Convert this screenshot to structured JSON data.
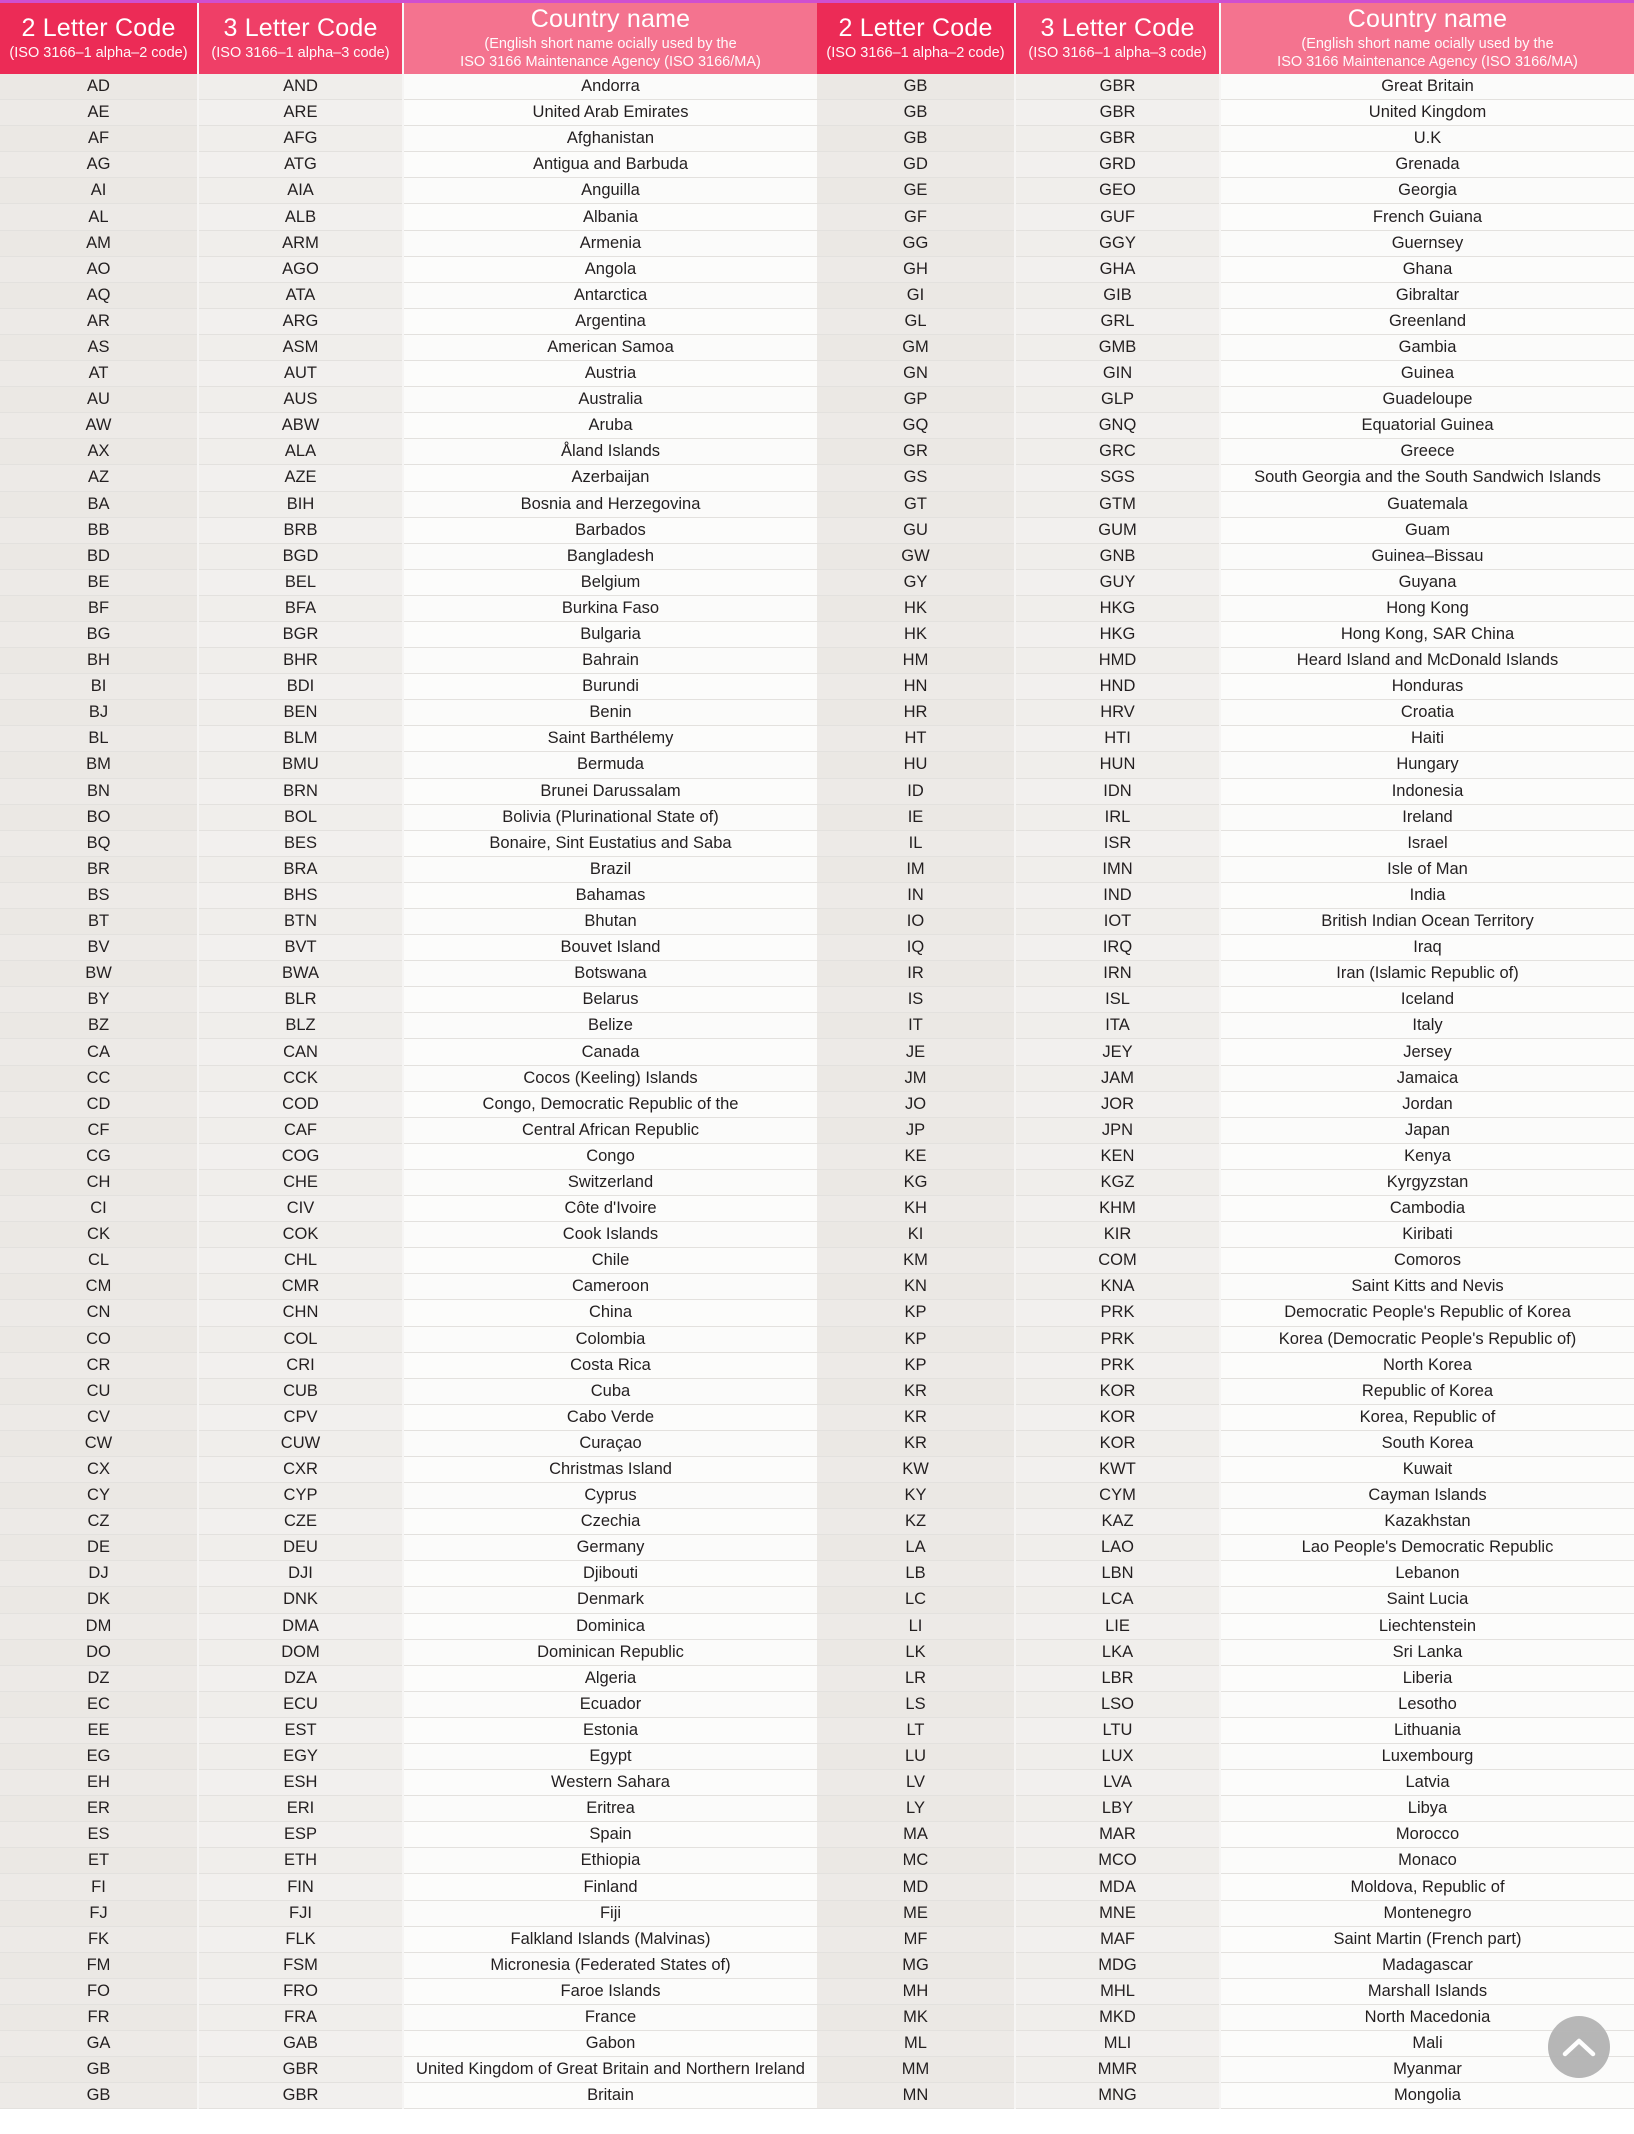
{
  "headers": {
    "code2_title": "2 Letter Code",
    "code2_sub": "(ISO 3166–1 alpha–2 code)",
    "code3_title": "3 Letter Code",
    "code3_sub": "(ISO 3166–1 alpha–3 code)",
    "name_title": "Country name",
    "name_sub_line1": "(English short name ocially used by the",
    "name_sub_line2": "ISO 3166 Maintenance Agency (ISO 3166/MA)"
  },
  "colors": {
    "header_code2": "#ec2b56",
    "header_code3": "#ef3f67",
    "header_name": "#f4738f",
    "top_accent": "#cf4fd0",
    "row_code_bg": "#ebe8e4",
    "row_name_bg": "#fbfbfa",
    "row_border": "#e3e1de",
    "scroll_btn_bg": "#b3b3b3"
  },
  "scroll_top_button": {
    "icon": "chevron-up-icon",
    "label": "Scroll to top"
  },
  "left_table": [
    [
      "AD",
      "AND",
      "Andorra"
    ],
    [
      "AE",
      "ARE",
      "United Arab Emirates"
    ],
    [
      "AF",
      "AFG",
      "Afghanistan"
    ],
    [
      "AG",
      "ATG",
      "Antigua and Barbuda"
    ],
    [
      "AI",
      "AIA",
      "Anguilla"
    ],
    [
      "AL",
      "ALB",
      "Albania"
    ],
    [
      "AM",
      "ARM",
      "Armenia"
    ],
    [
      "AO",
      "AGO",
      "Angola"
    ],
    [
      "AQ",
      "ATA",
      "Antarctica"
    ],
    [
      "AR",
      "ARG",
      "Argentina"
    ],
    [
      "AS",
      "ASM",
      "American Samoa"
    ],
    [
      "AT",
      "AUT",
      "Austria"
    ],
    [
      "AU",
      "AUS",
      "Australia"
    ],
    [
      "AW",
      "ABW",
      "Aruba"
    ],
    [
      "AX",
      "ALA",
      "Åland Islands"
    ],
    [
      "AZ",
      "AZE",
      "Azerbaijan"
    ],
    [
      "BA",
      "BIH",
      "Bosnia and Herzegovina"
    ],
    [
      "BB",
      "BRB",
      "Barbados"
    ],
    [
      "BD",
      "BGD",
      "Bangladesh"
    ],
    [
      "BE",
      "BEL",
      "Belgium"
    ],
    [
      "BF",
      "BFA",
      "Burkina Faso"
    ],
    [
      "BG",
      "BGR",
      "Bulgaria"
    ],
    [
      "BH",
      "BHR",
      "Bahrain"
    ],
    [
      "BI",
      "BDI",
      "Burundi"
    ],
    [
      "BJ",
      "BEN",
      "Benin"
    ],
    [
      "BL",
      "BLM",
      "Saint Barthélemy"
    ],
    [
      "BM",
      "BMU",
      "Bermuda"
    ],
    [
      "BN",
      "BRN",
      "Brunei Darussalam"
    ],
    [
      "BO",
      "BOL",
      "Bolivia (Plurinational State of)"
    ],
    [
      "BQ",
      "BES",
      "Bonaire, Sint Eustatius and Saba"
    ],
    [
      "BR",
      "BRA",
      "Brazil"
    ],
    [
      "BS",
      "BHS",
      "Bahamas"
    ],
    [
      "BT",
      "BTN",
      "Bhutan"
    ],
    [
      "BV",
      "BVT",
      "Bouvet Island"
    ],
    [
      "BW",
      "BWA",
      "Botswana"
    ],
    [
      "BY",
      "BLR",
      "Belarus"
    ],
    [
      "BZ",
      "BLZ",
      "Belize"
    ],
    [
      "CA",
      "CAN",
      "Canada"
    ],
    [
      "CC",
      "CCK",
      "Cocos (Keeling) Islands"
    ],
    [
      "CD",
      "COD",
      "Congo, Democratic Republic of the"
    ],
    [
      "CF",
      "CAF",
      "Central African Republic"
    ],
    [
      "CG",
      "COG",
      "Congo"
    ],
    [
      "CH",
      "CHE",
      "Switzerland"
    ],
    [
      "CI",
      "CIV",
      "Côte d'Ivoire"
    ],
    [
      "CK",
      "COK",
      "Cook Islands"
    ],
    [
      "CL",
      "CHL",
      "Chile"
    ],
    [
      "CM",
      "CMR",
      "Cameroon"
    ],
    [
      "CN",
      "CHN",
      "China"
    ],
    [
      "CO",
      "COL",
      "Colombia"
    ],
    [
      "CR",
      "CRI",
      "Costa Rica"
    ],
    [
      "CU",
      "CUB",
      "Cuba"
    ],
    [
      "CV",
      "CPV",
      "Cabo Verde"
    ],
    [
      "CW",
      "CUW",
      "Curaçao"
    ],
    [
      "CX",
      "CXR",
      "Christmas Island"
    ],
    [
      "CY",
      "CYP",
      "Cyprus"
    ],
    [
      "CZ",
      "CZE",
      "Czechia"
    ],
    [
      "DE",
      "DEU",
      "Germany"
    ],
    [
      "DJ",
      "DJI",
      "Djibouti"
    ],
    [
      "DK",
      "DNK",
      "Denmark"
    ],
    [
      "DM",
      "DMA",
      "Dominica"
    ],
    [
      "DO",
      "DOM",
      "Dominican Republic"
    ],
    [
      "DZ",
      "DZA",
      "Algeria"
    ],
    [
      "EC",
      "ECU",
      "Ecuador"
    ],
    [
      "EE",
      "EST",
      "Estonia"
    ],
    [
      "EG",
      "EGY",
      "Egypt"
    ],
    [
      "EH",
      "ESH",
      "Western Sahara"
    ],
    [
      "ER",
      "ERI",
      "Eritrea"
    ],
    [
      "ES",
      "ESP",
      "Spain"
    ],
    [
      "ET",
      "ETH",
      "Ethiopia"
    ],
    [
      "FI",
      "FIN",
      "Finland"
    ],
    [
      "FJ",
      "FJI",
      "Fiji"
    ],
    [
      "FK",
      "FLK",
      "Falkland Islands (Malvinas)"
    ],
    [
      "FM",
      "FSM",
      "Micronesia (Federated States of)"
    ],
    [
      "FO",
      "FRO",
      "Faroe Islands"
    ],
    [
      "FR",
      "FRA",
      "France"
    ],
    [
      "GA",
      "GAB",
      "Gabon"
    ],
    [
      "GB",
      "GBR",
      "United Kingdom of Great Britain and Northern Ireland"
    ],
    [
      "GB",
      "GBR",
      "Britain"
    ]
  ],
  "right_table": [
    [
      "GB",
      "GBR",
      "Great Britain"
    ],
    [
      "GB",
      "GBR",
      "United Kingdom"
    ],
    [
      "GB",
      "GBR",
      "U.K"
    ],
    [
      "GD",
      "GRD",
      "Grenada"
    ],
    [
      "GE",
      "GEO",
      "Georgia"
    ],
    [
      "GF",
      "GUF",
      "French Guiana"
    ],
    [
      "GG",
      "GGY",
      "Guernsey"
    ],
    [
      "GH",
      "GHA",
      "Ghana"
    ],
    [
      "GI",
      "GIB",
      "Gibraltar"
    ],
    [
      "GL",
      "GRL",
      "Greenland"
    ],
    [
      "GM",
      "GMB",
      "Gambia"
    ],
    [
      "GN",
      "GIN",
      "Guinea"
    ],
    [
      "GP",
      "GLP",
      "Guadeloupe"
    ],
    [
      "GQ",
      "GNQ",
      "Equatorial Guinea"
    ],
    [
      "GR",
      "GRC",
      "Greece"
    ],
    [
      "GS",
      "SGS",
      "South Georgia and the South Sandwich Islands"
    ],
    [
      "GT",
      "GTM",
      "Guatemala"
    ],
    [
      "GU",
      "GUM",
      "Guam"
    ],
    [
      "GW",
      "GNB",
      "Guinea–Bissau"
    ],
    [
      "GY",
      "GUY",
      "Guyana"
    ],
    [
      "HK",
      "HKG",
      "Hong Kong"
    ],
    [
      "HK",
      "HKG",
      "Hong Kong, SAR China"
    ],
    [
      "HM",
      "HMD",
      "Heard Island and McDonald Islands"
    ],
    [
      "HN",
      "HND",
      "Honduras"
    ],
    [
      "HR",
      "HRV",
      "Croatia"
    ],
    [
      "HT",
      "HTI",
      "Haiti"
    ],
    [
      "HU",
      "HUN",
      "Hungary"
    ],
    [
      "ID",
      "IDN",
      "Indonesia"
    ],
    [
      "IE",
      "IRL",
      "Ireland"
    ],
    [
      "IL",
      "ISR",
      "Israel"
    ],
    [
      "IM",
      "IMN",
      "Isle of Man"
    ],
    [
      "IN",
      "IND",
      "India"
    ],
    [
      "IO",
      "IOT",
      "British Indian Ocean Territory"
    ],
    [
      "IQ",
      "IRQ",
      "Iraq"
    ],
    [
      "IR",
      "IRN",
      "Iran (Islamic Republic of)"
    ],
    [
      "IS",
      "ISL",
      "Iceland"
    ],
    [
      "IT",
      "ITA",
      "Italy"
    ],
    [
      "JE",
      "JEY",
      "Jersey"
    ],
    [
      "JM",
      "JAM",
      "Jamaica"
    ],
    [
      "JO",
      "JOR",
      "Jordan"
    ],
    [
      "JP",
      "JPN",
      "Japan"
    ],
    [
      "KE",
      "KEN",
      "Kenya"
    ],
    [
      "KG",
      "KGZ",
      "Kyrgyzstan"
    ],
    [
      "KH",
      "KHM",
      "Cambodia"
    ],
    [
      "KI",
      "KIR",
      "Kiribati"
    ],
    [
      "KM",
      "COM",
      "Comoros"
    ],
    [
      "KN",
      "KNA",
      "Saint Kitts and Nevis"
    ],
    [
      "KP",
      "PRK",
      "Democratic People's Republic of Korea"
    ],
    [
      "KP",
      "PRK",
      "Korea (Democratic People's Republic of)"
    ],
    [
      "KP",
      "PRK",
      "North Korea"
    ],
    [
      "KR",
      "KOR",
      "Republic of Korea"
    ],
    [
      "KR",
      "KOR",
      "Korea, Republic of"
    ],
    [
      "KR",
      "KOR",
      "South Korea"
    ],
    [
      "KW",
      "KWT",
      "Kuwait"
    ],
    [
      "KY",
      "CYM",
      "Cayman Islands"
    ],
    [
      "KZ",
      "KAZ",
      "Kazakhstan"
    ],
    [
      "LA",
      "LAO",
      "Lao People's Democratic Republic"
    ],
    [
      "LB",
      "LBN",
      "Lebanon"
    ],
    [
      "LC",
      "LCA",
      "Saint Lucia"
    ],
    [
      "LI",
      "LIE",
      "Liechtenstein"
    ],
    [
      "LK",
      "LKA",
      "Sri Lanka"
    ],
    [
      "LR",
      "LBR",
      "Liberia"
    ],
    [
      "LS",
      "LSO",
      "Lesotho"
    ],
    [
      "LT",
      "LTU",
      "Lithuania"
    ],
    [
      "LU",
      "LUX",
      "Luxembourg"
    ],
    [
      "LV",
      "LVA",
      "Latvia"
    ],
    [
      "LY",
      "LBY",
      "Libya"
    ],
    [
      "MA",
      "MAR",
      "Morocco"
    ],
    [
      "MC",
      "MCO",
      "Monaco"
    ],
    [
      "MD",
      "MDA",
      "Moldova, Republic of"
    ],
    [
      "ME",
      "MNE",
      "Montenegro"
    ],
    [
      "MF",
      "MAF",
      "Saint Martin (French part)"
    ],
    [
      "MG",
      "MDG",
      "Madagascar"
    ],
    [
      "MH",
      "MHL",
      "Marshall Islands"
    ],
    [
      "MK",
      "MKD",
      "North Macedonia"
    ],
    [
      "ML",
      "MLI",
      "Mali"
    ],
    [
      "MM",
      "MMR",
      "Myanmar"
    ],
    [
      "MN",
      "MNG",
      "Mongolia"
    ]
  ]
}
